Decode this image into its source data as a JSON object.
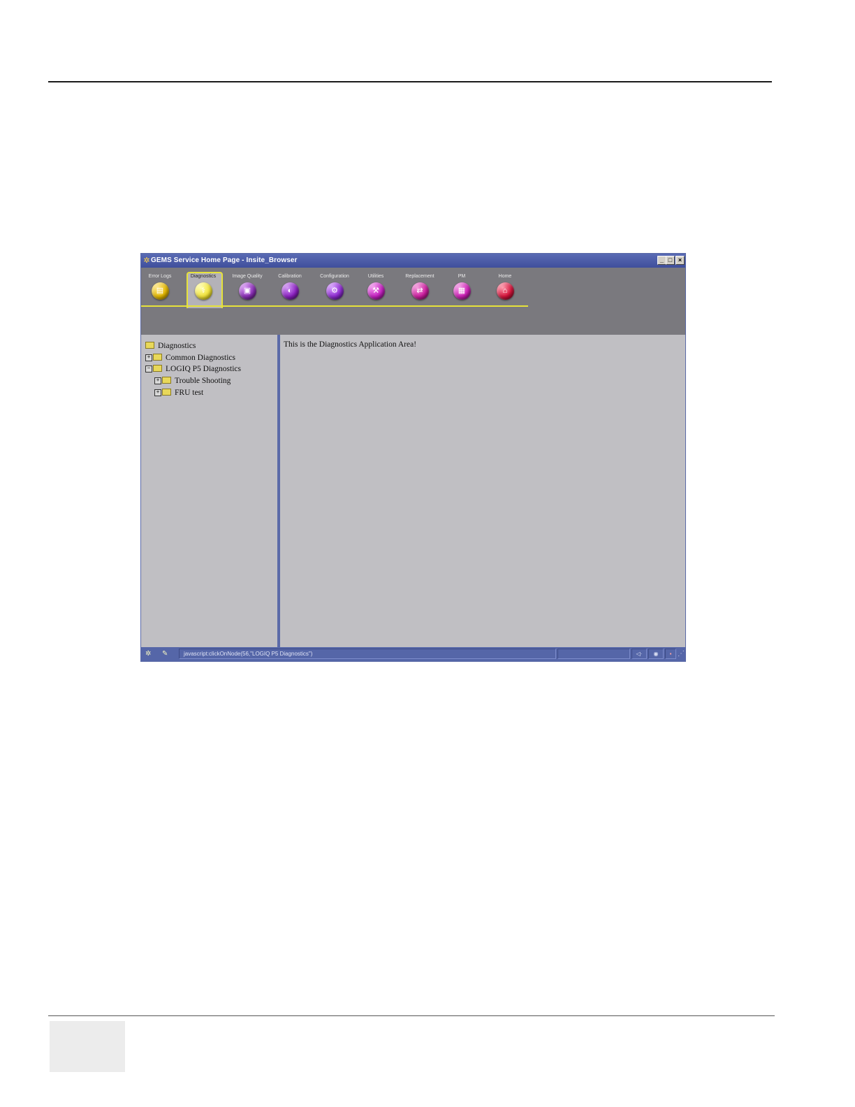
{
  "window": {
    "title": "GEMS Service Home Page - Insite_Browser"
  },
  "toolbar": {
    "items": [
      {
        "label": "Error Logs",
        "color": "#e2b600",
        "icon": "log-icon"
      },
      {
        "label": "Diagnostics",
        "color": "#f0e23a",
        "icon": "stethoscope-icon"
      },
      {
        "label": "Image Quality",
        "color": "#8a2fb5",
        "icon": "image-icon"
      },
      {
        "label": "Calibration",
        "color": "#8a1fc0",
        "icon": "calibration-icon"
      },
      {
        "label": "Configuration",
        "color": "#8d2ad0",
        "icon": "configuration-icon"
      },
      {
        "label": "Utilities",
        "color": "#c21fbf",
        "icon": "utilities-icon"
      },
      {
        "label": "Replacement",
        "color": "#cb1c9e",
        "icon": "replacement-icon"
      },
      {
        "label": "PM",
        "color": "#cc1fb5",
        "icon": "pm-icon"
      },
      {
        "label": "Home",
        "color": "#d3123a",
        "icon": "home-icon"
      }
    ],
    "accent": "#e6e23a"
  },
  "tree": {
    "root": "Diagnostics",
    "items": [
      {
        "label": "Common Diagnostics",
        "expander": "+"
      },
      {
        "label": "LOGIQ P5 Diagnostics",
        "expander": "−"
      },
      {
        "label": "Trouble Shooting",
        "expander": "+"
      },
      {
        "label": "FRU test",
        "expander": "+"
      }
    ]
  },
  "main": {
    "text": "This is the Diagnostics Application Area!"
  },
  "statusbar": {
    "text": "javascript:clickOnNode(56,\"LOGIQ P5 Diagnostics\")"
  }
}
